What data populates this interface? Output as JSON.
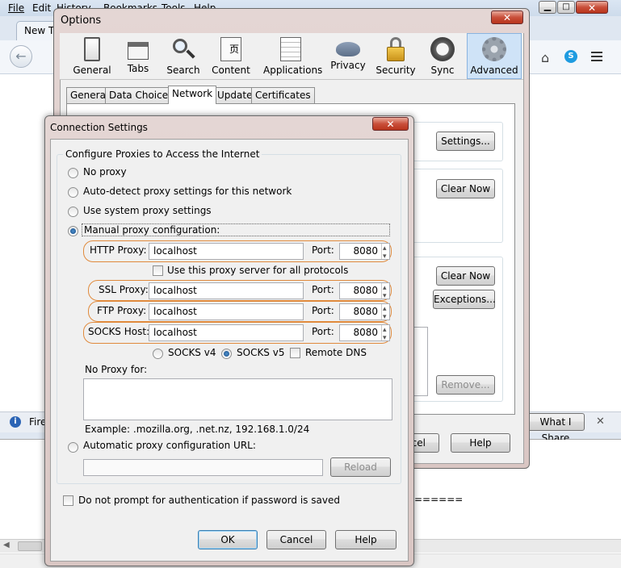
{
  "browser": {
    "menu": [
      "File",
      "Edit",
      "History",
      "Bookmarks",
      "Tools",
      "Help"
    ],
    "tab_title": "New Ta",
    "notification_text": "Fire",
    "share_button": "What I Share",
    "equals_text": "======"
  },
  "options": {
    "title": "Options",
    "toolbar": [
      "General",
      "Tabs",
      "Search",
      "Content",
      "Applications",
      "Privacy",
      "Security",
      "Sync",
      "Advanced"
    ],
    "tabs": [
      "General",
      "Data Choices",
      "Network",
      "Update",
      "Certificates"
    ],
    "settings_button": "Settings...",
    "clear_now_1": "Clear Now",
    "clear_now_2": "Clear Now",
    "exceptions_button": "Exceptions...",
    "remove_button": "Remove...",
    "cancel_partial": "cel",
    "help_button": "Help"
  },
  "connection": {
    "title": "Connection Settings",
    "group_title": "Configure Proxies to Access the Internet",
    "options": [
      "No proxy",
      "Auto-detect proxy settings for this network",
      "Use system proxy settings",
      "Manual proxy configuration:"
    ],
    "selected_option": "Manual proxy configuration:",
    "http_label": "HTTP Proxy:",
    "http_value": "localhost",
    "http_port": "8080",
    "all_protocols_label": "Use this proxy server for all protocols",
    "ssl_label": "SSL Proxy:",
    "ssl_value": "localhost",
    "ssl_port": "8080",
    "ftp_label": "FTP Proxy:",
    "ftp_value": "localhost",
    "ftp_port": "8080",
    "socks_label": "SOCKS Host:",
    "socks_value": "localhost",
    "socks_port": "8080",
    "port_label": "Port:",
    "socks_v4": "SOCKS v4",
    "socks_v5": "SOCKS v5",
    "remote_dns": "Remote DNS",
    "no_proxy_label": "No Proxy for:",
    "no_proxy_value": "",
    "example_text": "Example: .mozilla.org, .net.nz, 192.168.1.0/24",
    "auto_config_label": "Automatic proxy configuration URL:",
    "auto_config_value": "",
    "reload_button": "Reload",
    "no_prompt_label": "Do not prompt for authentication if password is saved",
    "ok_button": "OK",
    "cancel_button": "Cancel",
    "help_button": "Help"
  },
  "colors": {
    "highlight_oval": "#e08a3c",
    "selected_toolbar": "#cfe3f7"
  }
}
